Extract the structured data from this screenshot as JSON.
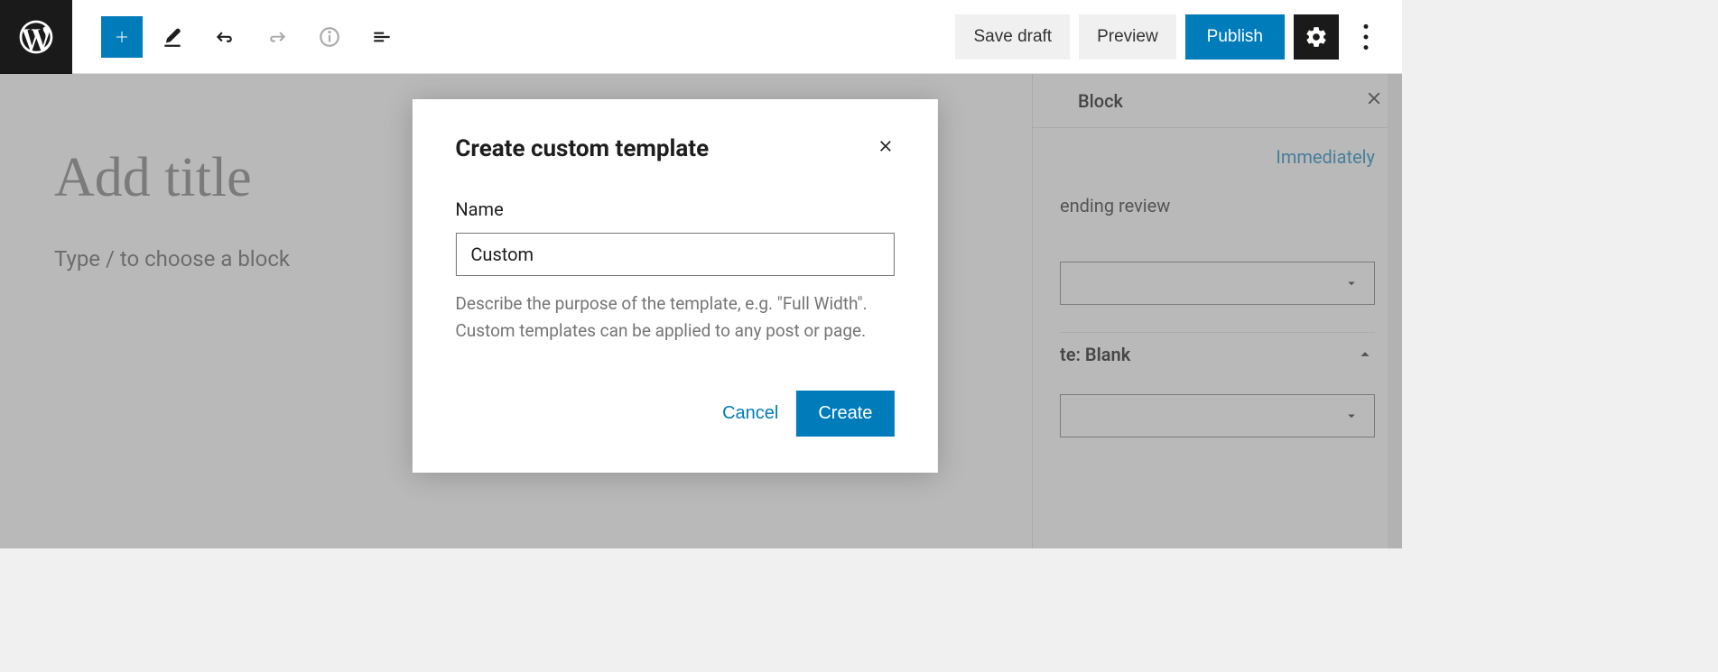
{
  "toolbar": {
    "save_draft": "Save draft",
    "preview": "Preview",
    "publish": "Publish"
  },
  "editor": {
    "title_placeholder": "Add title",
    "block_placeholder": "Type / to choose a block"
  },
  "sidebar": {
    "tab_block": "Block",
    "immediately": "Immediately",
    "pending_review": "ending review",
    "template_panel": "te: Blank"
  },
  "modal": {
    "title": "Create custom template",
    "name_label": "Name",
    "name_value": "Custom",
    "hint": "Describe the purpose of the template, e.g. \"Full Width\". Custom templates can be applied to any post or page.",
    "cancel": "Cancel",
    "create": "Create"
  }
}
